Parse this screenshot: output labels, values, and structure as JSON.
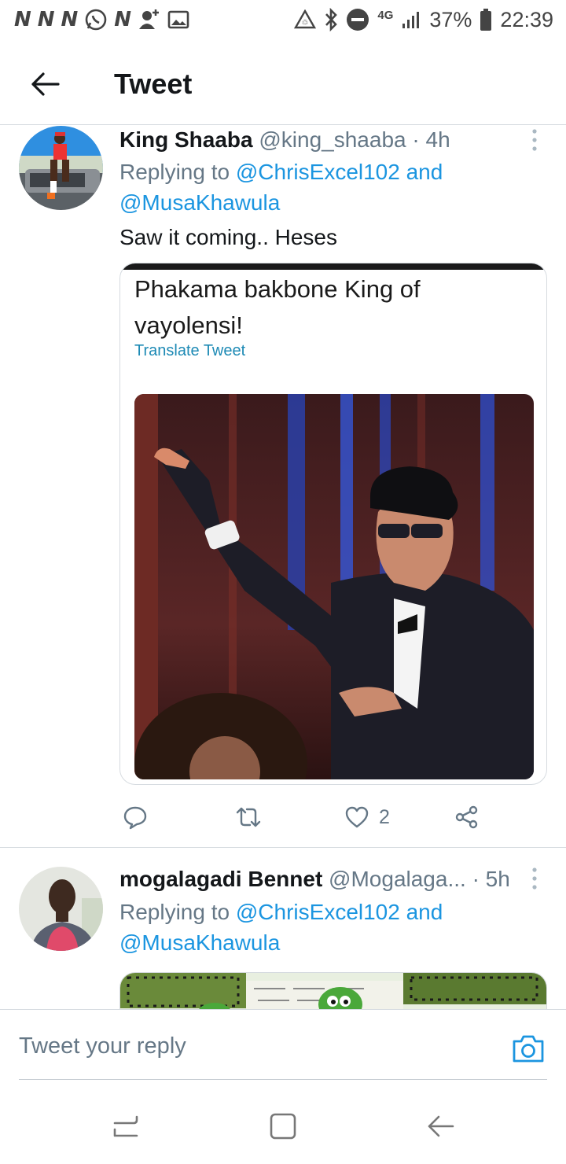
{
  "status_bar": {
    "left_letters": [
      "N",
      "N",
      "N",
      "N"
    ],
    "network": "4G",
    "battery": "37%",
    "time": "22:39"
  },
  "header": {
    "title": "Tweet"
  },
  "tweets": [
    {
      "name": "King Shaaba",
      "handle": "@king_shaaba",
      "time": "· 4h",
      "replying_prefix": "Replying to ",
      "replying_mention_1": "@ChrisExcel102",
      "replying_and": " and",
      "replying_mention_2": "@MusaKhawula",
      "text": "Saw it coming.. Heses",
      "quoted_text": "Phakama bakbone King of vayolensi!",
      "quoted_translate": "Translate Tweet",
      "likes": "2"
    },
    {
      "name": "mogalagadi Bennet",
      "handle": "@Mogalaga...",
      "time": "· 5h",
      "replying_prefix": "Replying to ",
      "replying_mention_1": "@ChrisExcel102",
      "replying_and": " and",
      "replying_mention_2": "@MusaKhawula"
    }
  ],
  "reply": {
    "placeholder": "Tweet your reply"
  },
  "colors": {
    "link": "#1b95e0",
    "secondary_text": "#657786",
    "divider": "#d6dbe0"
  },
  "icons": [
    "back-arrow-icon",
    "more-vertical-icon",
    "reply-icon",
    "retweet-icon",
    "like-icon",
    "share-icon",
    "camera-icon",
    "recents-icon",
    "home-icon",
    "nav-back-icon"
  ]
}
